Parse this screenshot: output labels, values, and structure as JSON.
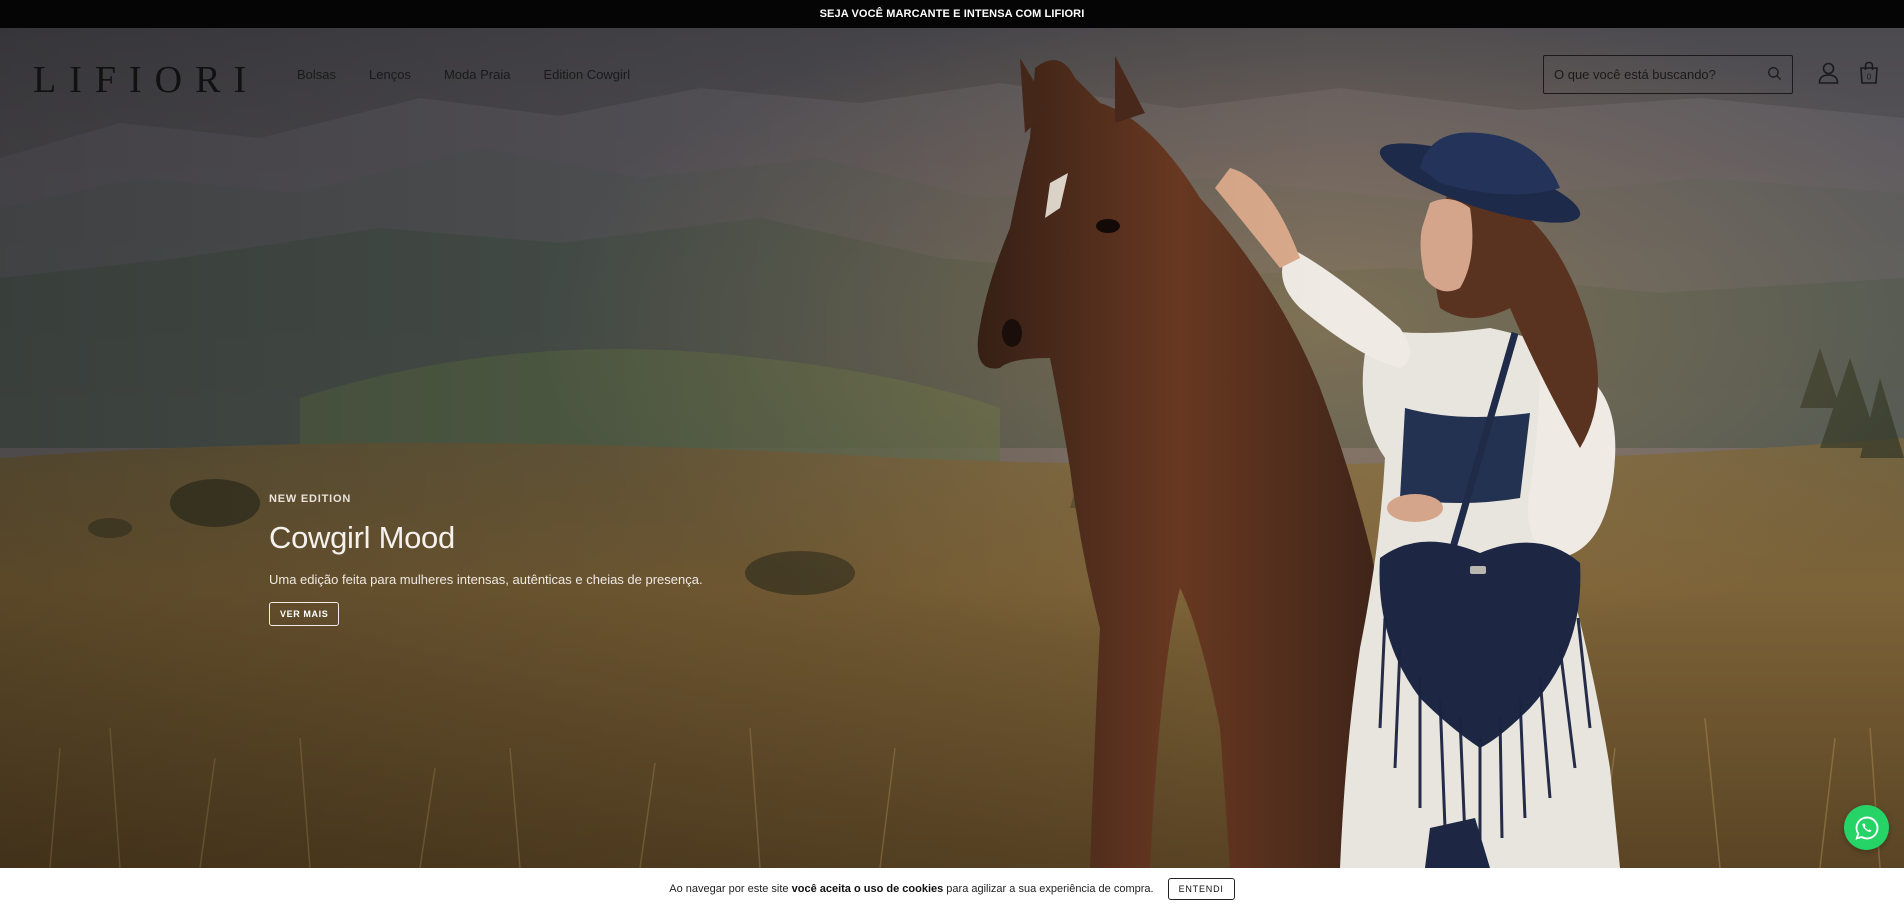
{
  "announcement": {
    "text": "SEJA VOCÊ MARCANTE E INTENSA COM LIFIORI"
  },
  "header": {
    "logo": "LIFIORI",
    "nav": [
      {
        "label": "Bolsas"
      },
      {
        "label": "Lenços"
      },
      {
        "label": "Moda Praia"
      },
      {
        "label": "Edition Cowgirl"
      }
    ],
    "search": {
      "placeholder": "O que você está buscando?"
    },
    "cart_count": "0",
    "icons": [
      "search-icon",
      "user-icon",
      "shopping-bag-icon"
    ]
  },
  "hero": {
    "eyebrow": "NEW EDITION",
    "title": "Cowgirl Mood",
    "subtitle": "Uma edição feita para mulheres intensas, autênticas e cheias de presença.",
    "cta": "VER MAIS"
  },
  "whatsapp": {
    "icon": "whatsapp-icon",
    "color": "#25d366"
  },
  "cookie_bar": {
    "text_before": "Ao navegar por este site",
    "text_bold": "você aceita o uso de cookies",
    "text_after": "para agilizar a sua experiência de compra.",
    "button": "ENTENDI"
  },
  "colors": {
    "announcement_bg": "#050505",
    "text_dark": "#111111",
    "hero_text": "#ffffff"
  }
}
